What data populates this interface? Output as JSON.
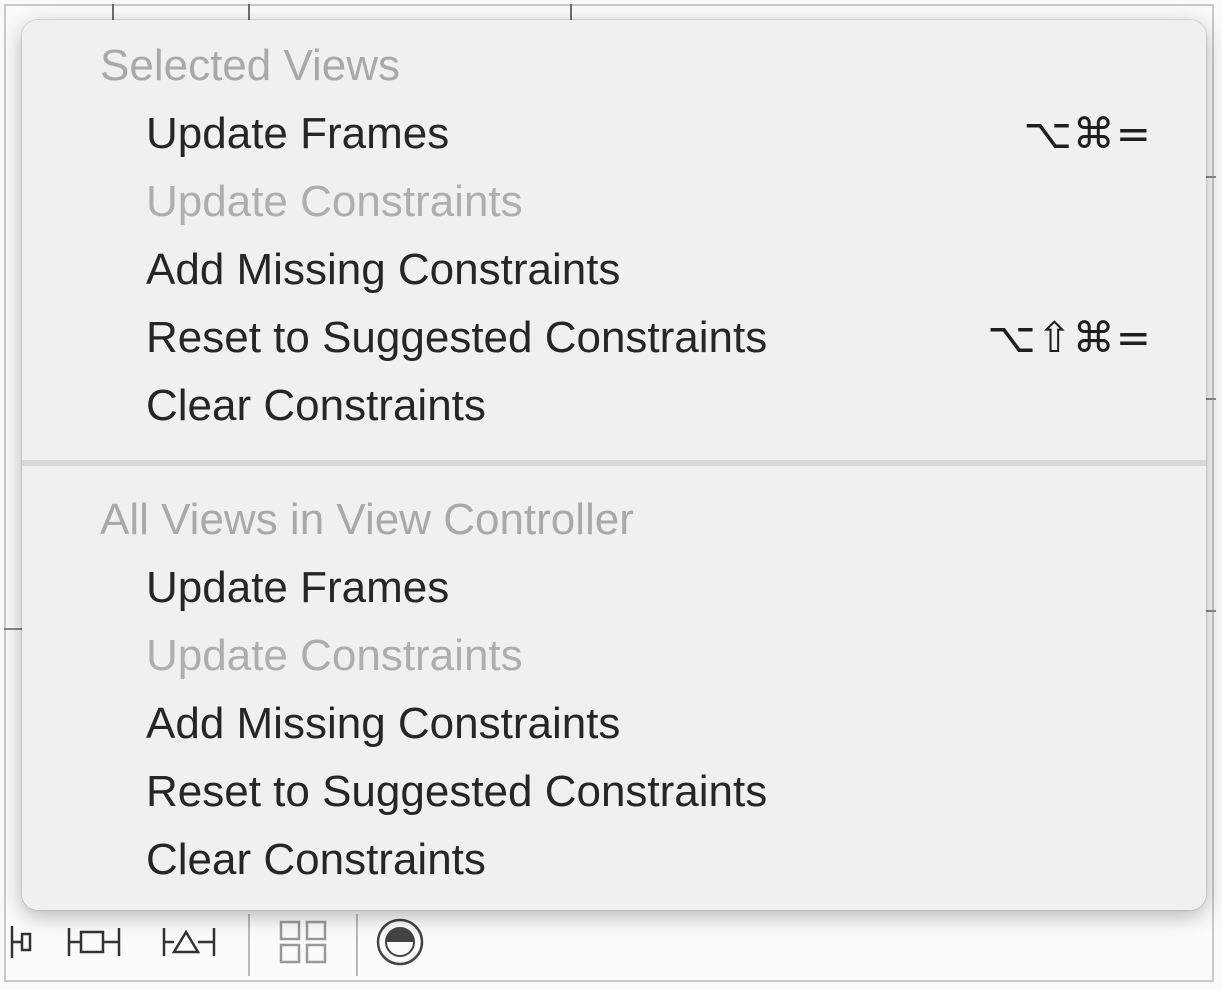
{
  "menu": {
    "sections": [
      {
        "header": "Selected Views",
        "items": [
          {
            "label": "Update Frames",
            "shortcut": "⌥⌘=",
            "enabled": true
          },
          {
            "label": "Update Constraints",
            "shortcut": "",
            "enabled": false
          },
          {
            "label": "Add Missing Constraints",
            "shortcut": "",
            "enabled": true
          },
          {
            "label": "Reset to Suggested Constraints",
            "shortcut": "⌥⇧⌘=",
            "enabled": true
          },
          {
            "label": "Clear Constraints",
            "shortcut": "",
            "enabled": true
          }
        ]
      },
      {
        "header": "All Views in View Controller",
        "items": [
          {
            "label": "Update Frames",
            "shortcut": "",
            "enabled": true
          },
          {
            "label": "Update Constraints",
            "shortcut": "",
            "enabled": false
          },
          {
            "label": "Add Missing Constraints",
            "shortcut": "",
            "enabled": true
          },
          {
            "label": "Reset to Suggested Constraints",
            "shortcut": "",
            "enabled": true
          },
          {
            "label": "Clear Constraints",
            "shortcut": "",
            "enabled": true
          }
        ]
      }
    ]
  },
  "toolbar": {
    "icons": [
      "align-icon",
      "pin-icon",
      "resolve-issues-icon",
      "embed-in-stack-icon",
      "resizing-behavior-icon"
    ]
  },
  "colors": {
    "menu_background": "#f0f0f0",
    "enabled_text": "#262626",
    "disabled_text": "#aeaeae",
    "header_text": "#a9a9a9"
  }
}
